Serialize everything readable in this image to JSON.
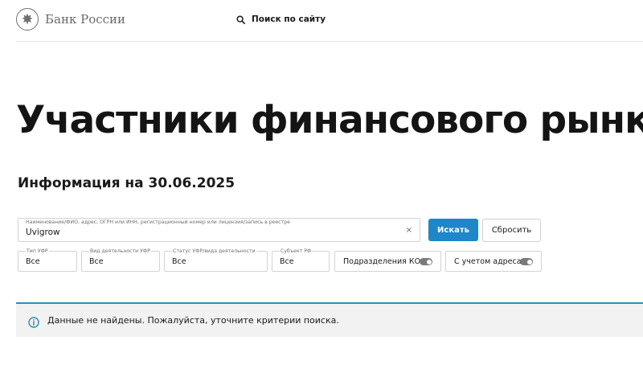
{
  "header": {
    "logo_text": "Банк России",
    "search_label": "Поиск по сайту"
  },
  "main": {
    "title": "Участники финансового рынка",
    "info_date": "Информация на 30.06.2025"
  },
  "search": {
    "label": "Наименование/ФИО, адрес, ОГРН или ИНН, регистрационный номер или лицензия/запись в реестре",
    "value": "Uvigrow",
    "clear": "×",
    "submit_label": "Искать",
    "reset_label": "Сбросить"
  },
  "filters": [
    {
      "label": "Тип УФР",
      "value": "Все"
    },
    {
      "label": "Вид деятельности УФР",
      "value": "Все"
    },
    {
      "label": "Статус УФР/вида деятельности",
      "value": "Все"
    },
    {
      "label": "Субъект РФ",
      "value": "Все"
    }
  ],
  "toggles": [
    {
      "label": "Подразделения КО",
      "on": false
    },
    {
      "label": "С учетом адреса",
      "on": false
    }
  ],
  "alert": {
    "text": "Данные не найдены. Пожалуйста, уточните критерии поиска."
  },
  "colors": {
    "accent": "#1f86c8",
    "alert_border": "#2a8fb0",
    "alert_bg": "#f2f2f2"
  }
}
